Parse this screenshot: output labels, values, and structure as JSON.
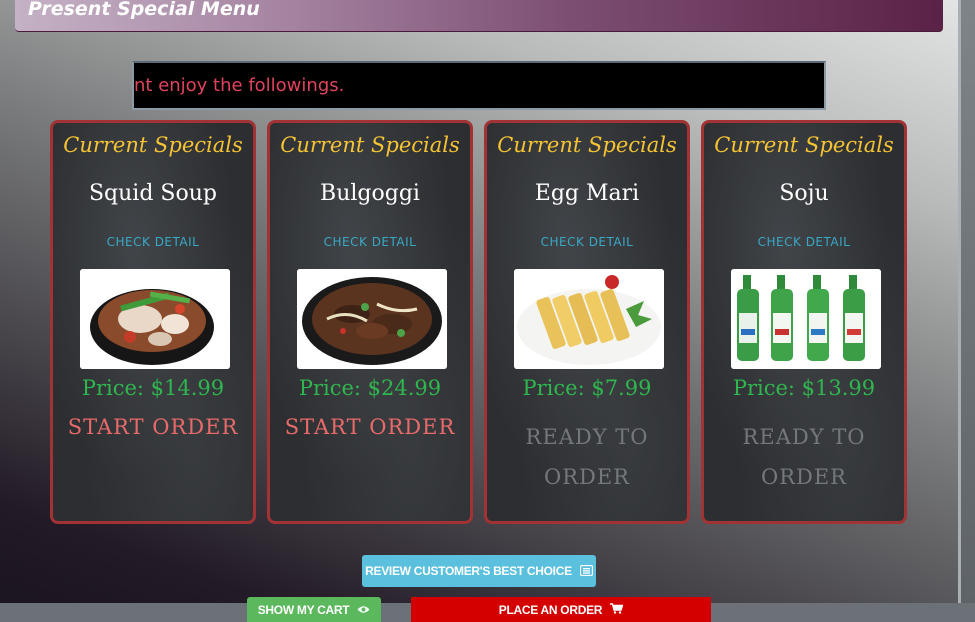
{
  "header": {
    "title": "Present Special Menu"
  },
  "marquee": {
    "text": "nt enjoy the followings."
  },
  "cards": [
    {
      "label": "Current Specials",
      "name": "Squid Soup",
      "detail": "CHECK DETAIL",
      "price": "Price: $14.99",
      "action": "START ORDER",
      "photo": "squid-soup-photo"
    },
    {
      "label": "Current Specials",
      "name": "Bulgoggi",
      "detail": "CHECK DETAIL",
      "price": "Price: $24.99",
      "action": "START ORDER",
      "photo": "bulgogi-photo"
    },
    {
      "label": "Current Specials",
      "name": "Egg Mari",
      "detail": "CHECK DETAIL",
      "price": "Price: $7.99",
      "status": "READY TO ORDER",
      "photo": "egg-roll-photo"
    },
    {
      "label": "Current Specials",
      "name": "Soju",
      "detail": "CHECK DETAIL",
      "price": "Price: $13.99",
      "status": "READY TO ORDER",
      "photo": "soju-bottles-photo"
    }
  ],
  "buttons": {
    "review": "REVIEW CUSTOMER'S BEST CHOICE",
    "show_cart": "SHOW MY CART",
    "place_order": "PLACE AN ORDER"
  },
  "icons": {
    "review": "list-icon",
    "show_cart": "eye-icon",
    "place_order": "cart-icon"
  },
  "colors": {
    "card_border": "#a23334",
    "label": "#f6c333",
    "price": "#2fb64e",
    "action": "#e86a6a",
    "detail": "#38a9c5",
    "marquee_text": "#e0435d",
    "review_button": "#5bc0de",
    "cart_button": "#5cb85c",
    "order_button": "#d40000"
  }
}
